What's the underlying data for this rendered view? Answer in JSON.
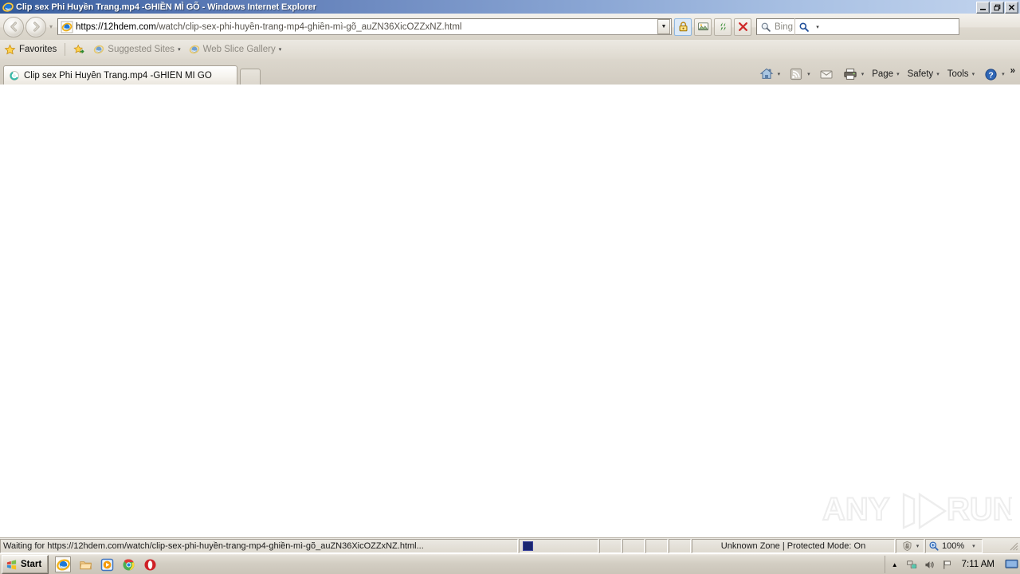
{
  "window": {
    "title": "Clip sex Phi Huyền Trang.mp4 -GHIỀN MÌ GÕ - Windows Internet Explorer",
    "icon": "internet-explorer-icon",
    "minimize_label": "_",
    "maximize_label": "❐",
    "close_label": "✕"
  },
  "navigation": {
    "back_label": "Back",
    "forward_label": "Forward",
    "recent_pages_caret": "▾"
  },
  "address_bar": {
    "scheme": "https://",
    "host": "12hdem.com",
    "path": "/watch/clip-sex-phi-huyền-trang-mp4-ghiền-mì-gõ_auZN36XicOZZxNZ.html",
    "full_url": "https://12hdem.com/watch/clip-sex-phi-huyền-trang-mp4-ghiền-mì-gõ_auZN36XicOZZxNZ.html",
    "dropdown_caret": "▼",
    "buttons": [
      {
        "name": "security-lock-icon",
        "label": "Security Report"
      },
      {
        "name": "compatibility-view-icon",
        "label": "Compatibility View"
      },
      {
        "name": "refresh-icon",
        "label": "Refresh"
      },
      {
        "name": "stop-icon",
        "label": "Stop"
      }
    ]
  },
  "search": {
    "placeholder": "Bing",
    "go_icon": "search-icon",
    "dropdown_caret": "▾"
  },
  "favorites_bar": {
    "favorites_label": "Favorites",
    "items": [
      {
        "label": "Suggested Sites",
        "icon": "internet-explorer-icon",
        "caret": "▾"
      },
      {
        "label": "Web Slice Gallery",
        "icon": "internet-explorer-icon",
        "caret": "▾"
      }
    ]
  },
  "tabs": {
    "active": {
      "label": "Clip sex Phi Huyền Trang.mp4 -GHIỀN MÌ GÕ",
      "icon": "loading-spinner-icon"
    },
    "new_tab_label": ""
  },
  "command_bar": {
    "items": [
      {
        "name": "home-icon",
        "label": "",
        "caret": "▾"
      },
      {
        "name": "feeds-icon",
        "label": "",
        "caret": "▾"
      },
      {
        "name": "mail-icon",
        "label": ""
      },
      {
        "name": "print-icon",
        "label": "",
        "caret": "▾"
      },
      {
        "name": "page-menu",
        "label": "Page",
        "caret": "▾"
      },
      {
        "name": "safety-menu",
        "label": "Safety",
        "caret": "▾"
      },
      {
        "name": "tools-menu",
        "label": "Tools",
        "caret": "▾"
      },
      {
        "name": "help-menu",
        "label": "",
        "caret": "▾"
      }
    ],
    "overflow_label": "»"
  },
  "page": {
    "background": "#ffffff",
    "watermark_text_left": "ANY",
    "watermark_text_right": "RUN"
  },
  "status_bar": {
    "message": "Waiting for https://12hdem.com/watch/clip-sex-phi-huyền-trang-mp4-ghiền-mì-gõ_auZN36XicOZZxNZ.html...",
    "zone": "Unknown Zone | Protected Mode: On",
    "zoom": "100%",
    "zoom_caret": "▾",
    "zone_caret": "▾"
  },
  "taskbar": {
    "start_label": "Start",
    "quick_launch": [
      {
        "name": "internet-explorer-icon",
        "active": true
      },
      {
        "name": "file-explorer-icon",
        "active": false
      },
      {
        "name": "media-player-icon",
        "active": false
      },
      {
        "name": "google-chrome-icon",
        "active": false
      },
      {
        "name": "opera-icon",
        "active": false
      }
    ],
    "tray": {
      "expand_caret": "▲",
      "network_icon": "network-icon",
      "volume_icon": "volume-icon",
      "action_center_icon": "flag-icon",
      "time": "7:11 AM",
      "show_desktop": "show-desktop-icon"
    }
  },
  "colors": {
    "title_blue": "#3f64a4",
    "chrome_tan": "#d6d2c9",
    "progress_navy": "#1a2670",
    "accent_orange": "#f59b0b"
  }
}
